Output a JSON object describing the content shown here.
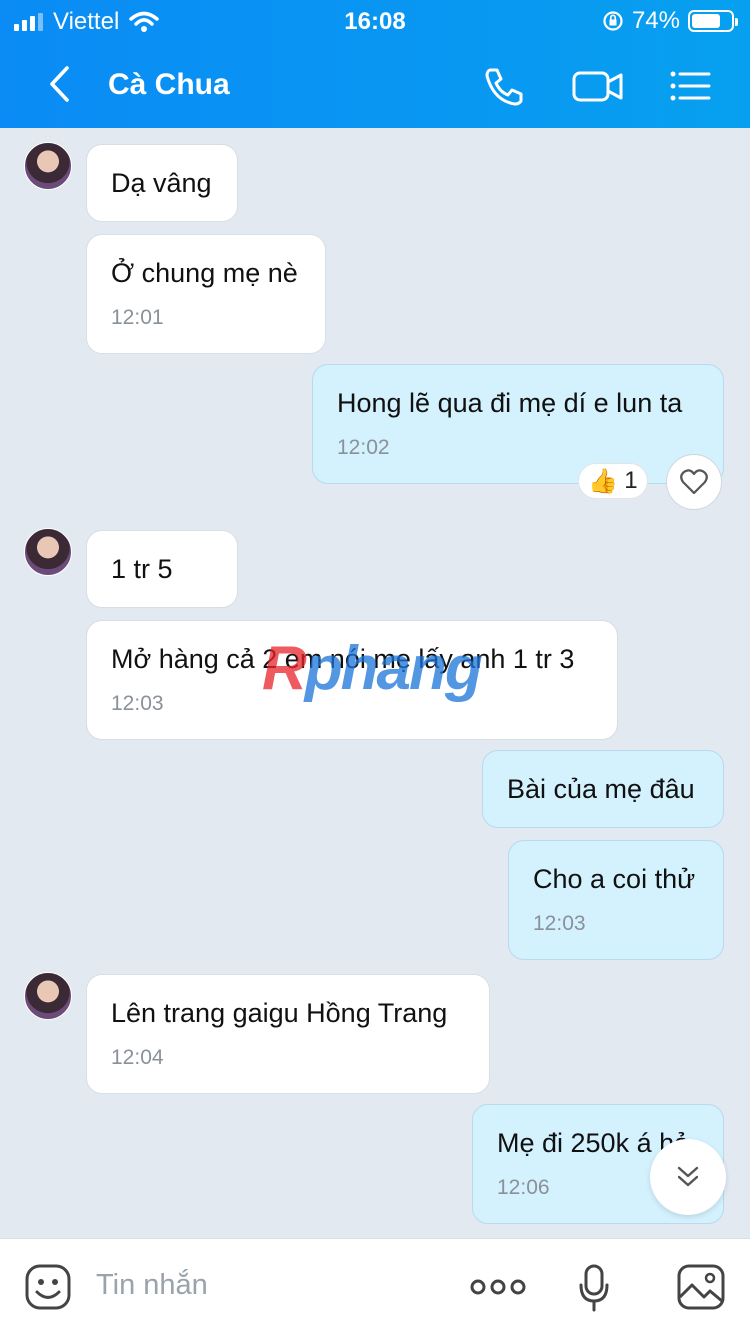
{
  "status_bar": {
    "carrier": "Viettel",
    "time": "16:08",
    "battery": "74%",
    "battery_level": 0.74
  },
  "header": {
    "contact_name": "Cà Chua"
  },
  "messages": [
    {
      "dir": "in",
      "text": "Dạ vâng",
      "time": ""
    },
    {
      "dir": "in",
      "text": "Ở chung mẹ nè",
      "time": "12:01"
    },
    {
      "dir": "out",
      "text": "Hong lẽ qua đi mẹ dí e lun ta",
      "time": "12:02"
    },
    {
      "dir": "in",
      "text": "1 tr 5",
      "time": ""
    },
    {
      "dir": "in",
      "text": "Mở hàng cả 2 em nói mẹ lấy anh 1 tr 3",
      "time": "12:03"
    },
    {
      "dir": "out",
      "text": "Bài của mẹ đâu",
      "time": ""
    },
    {
      "dir": "out",
      "text": "Cho a coi thử",
      "time": "12:03"
    },
    {
      "dir": "in",
      "text": "Lên trang gaigu Hồng Trang",
      "time": "12:04"
    },
    {
      "dir": "out",
      "text": "Mẹ đi 250k á hả",
      "time": "12:06"
    }
  ],
  "reaction": {
    "emoji": "👍",
    "count": "1"
  },
  "watermark": {
    "part1": "R",
    "part2": "phang"
  },
  "composer": {
    "placeholder": "Tin nhắn"
  },
  "colors": {
    "header": "#0a8bf5",
    "chat_bg": "#e2e9f1",
    "outgoing_bubble": "#d4f1fe",
    "incoming_bubble": "#ffffff"
  }
}
